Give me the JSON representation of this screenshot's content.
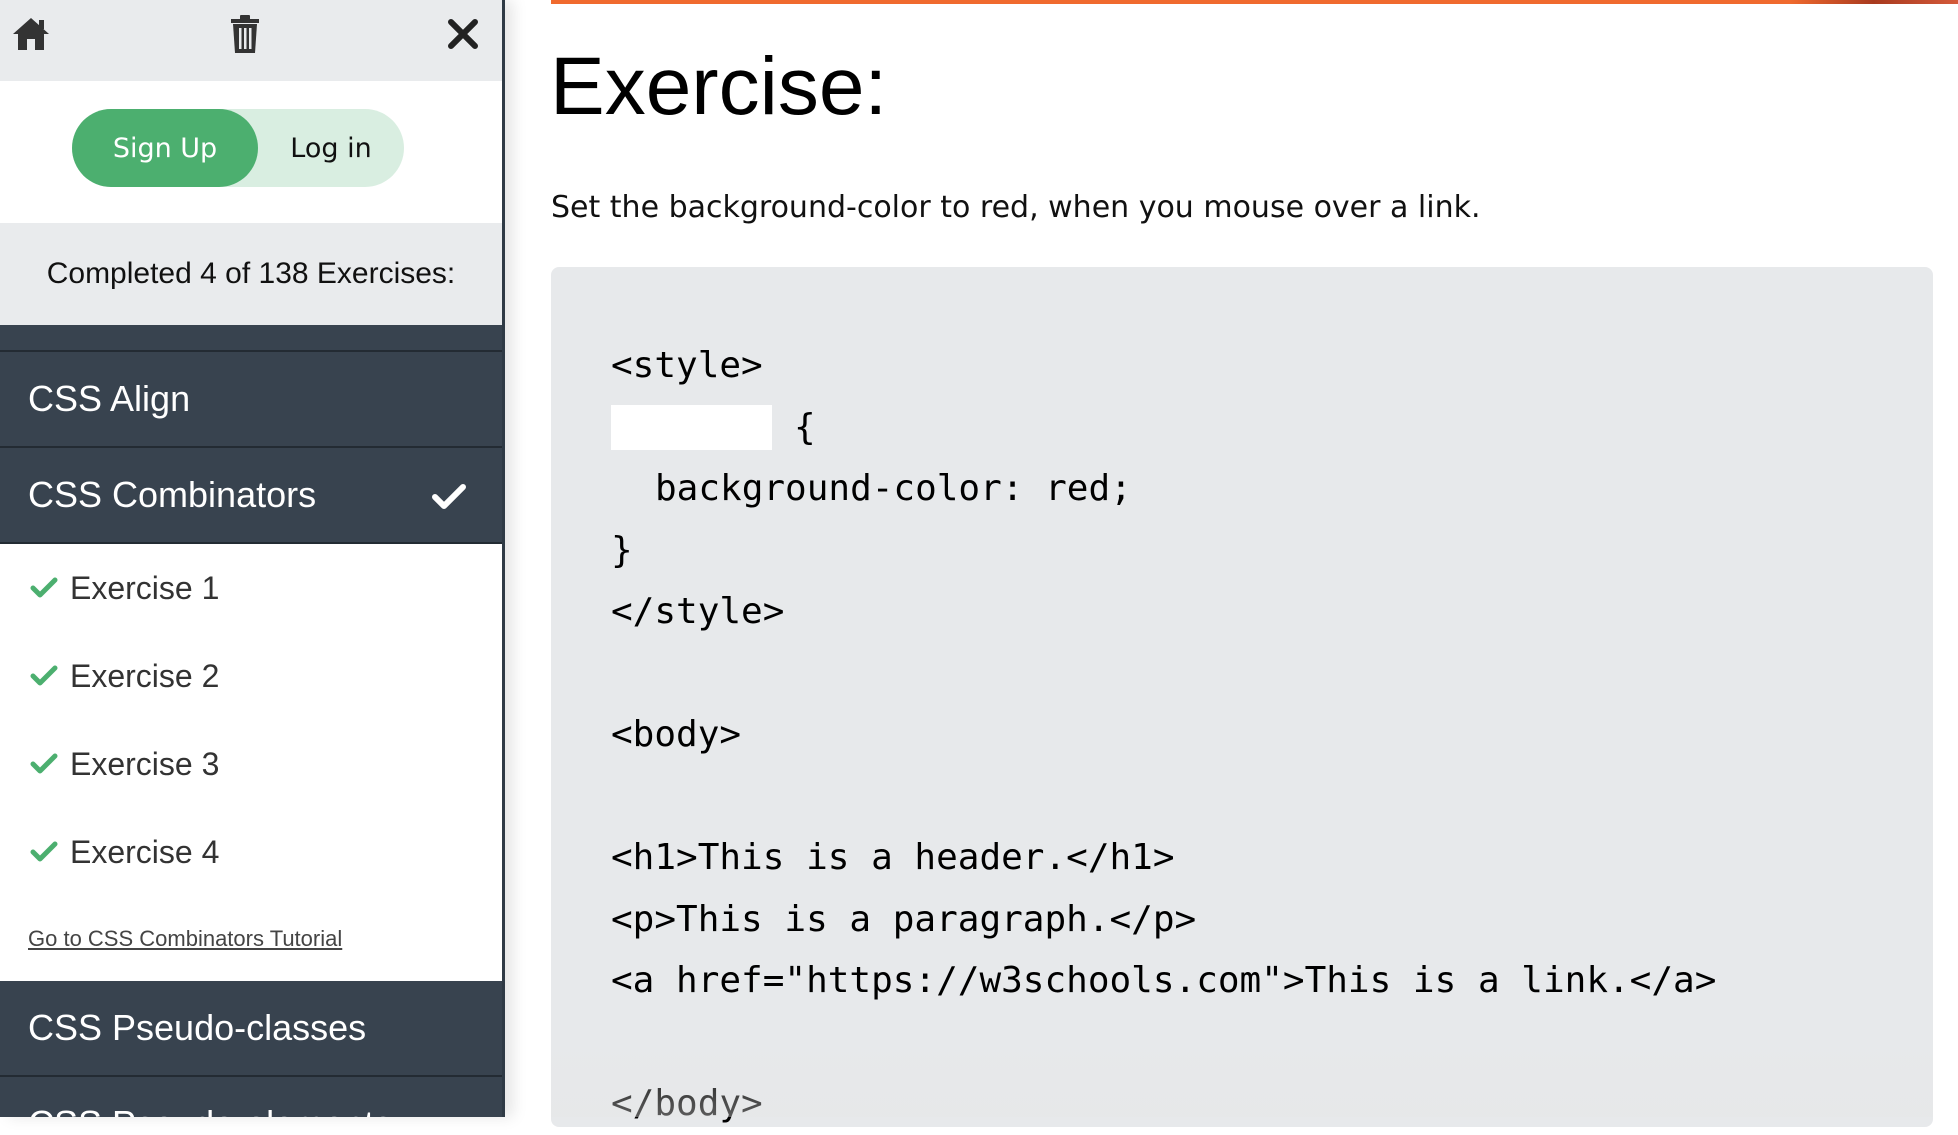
{
  "sidebar": {
    "topbar": {
      "home_icon": "home-icon",
      "trash_icon": "trash-icon",
      "close_icon": "close-icon"
    },
    "auth": {
      "signup_label": "Sign Up",
      "login_label": "Log in"
    },
    "progress_text": "Completed 4 of 138 Exercises:",
    "sections": [
      {
        "label": "CSS Align",
        "completed": false
      },
      {
        "label": "CSS Combinators",
        "completed": true
      },
      {
        "label": "CSS Pseudo-classes",
        "completed": false
      },
      {
        "label": "CSS Pseudo-elements",
        "completed": false
      }
    ],
    "exercises": [
      {
        "label": "Exercise 1",
        "done": true
      },
      {
        "label": "Exercise 2",
        "done": true
      },
      {
        "label": "Exercise 3",
        "done": true
      },
      {
        "label": "Exercise 4",
        "done": true
      }
    ],
    "tutorial_link": "Go to CSS Combinators Tutorial"
  },
  "main": {
    "title": "Exercise:",
    "instruction": "Set the background-color to red, when you mouse over a link.",
    "code": {
      "line1": "<style>",
      "line2_after_input": "{",
      "line3": "background-color: red;",
      "line4": "}",
      "line5": "</style>",
      "line7": "<body>",
      "line9": "<h1>This is a header.</h1>",
      "line10": "<p>This is a paragraph.</p>",
      "line11": "<a href=\"https://w3schools.com\">This is a link.</a>",
      "line13": "</body>"
    },
    "input_value": ""
  },
  "colors": {
    "accent": "#f06a2e",
    "green": "#4caf6f",
    "sidebar_dark": "#38434f",
    "code_bg": "#e7e9eb"
  }
}
